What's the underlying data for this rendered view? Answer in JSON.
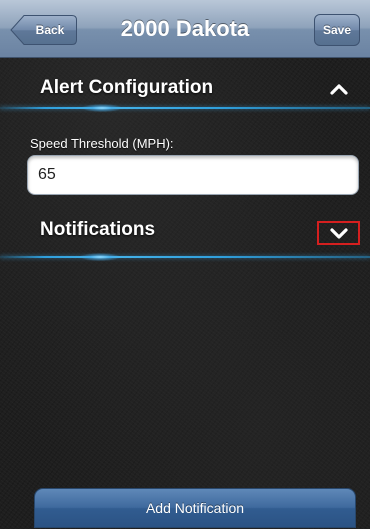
{
  "nav": {
    "title": "2000 Dakota",
    "back_label": "Back",
    "save_label": "Save"
  },
  "alert_section": {
    "title": "Alert Configuration",
    "state": "expanded",
    "speed_field": {
      "label": "Speed Threshold (MPH):",
      "value": "65"
    }
  },
  "notifications_section": {
    "title": "Notifications",
    "state": "collapsed",
    "highlight_color": "#d51f1f"
  },
  "footer": {
    "add_notification_label": "Add Notification"
  },
  "colors": {
    "nav_bar": "#7f97b4",
    "accent_line": "#2f9fdc",
    "background": "#1e1e1e",
    "button": "#3f6a9e"
  }
}
